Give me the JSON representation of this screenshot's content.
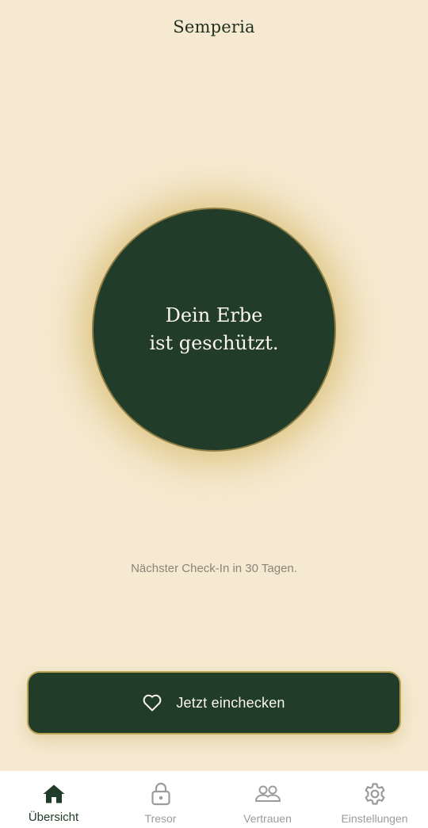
{
  "app": {
    "title": "Semperia"
  },
  "status": {
    "line1": "Dein Erbe",
    "line2": "ist geschützt."
  },
  "next_checkin": "Nächster Check-In in 30 Tagen.",
  "checkin_button": {
    "label": "Jetzt einchecken",
    "icon": "heart-icon"
  },
  "nav": {
    "items": [
      {
        "label": "Übersicht",
        "icon": "home-icon",
        "active": true
      },
      {
        "label": "Tresor",
        "icon": "lock-icon",
        "active": false
      },
      {
        "label": "Vertrauen",
        "icon": "people-icon",
        "active": false
      },
      {
        "label": "Einstellungen",
        "icon": "gear-icon",
        "active": false
      }
    ]
  },
  "colors": {
    "background": "#f5ead1",
    "primary": "#213c29",
    "accent_gold": "#b9a456",
    "muted_text": "#8a8578",
    "nav_inactive": "#9b9b9b"
  }
}
